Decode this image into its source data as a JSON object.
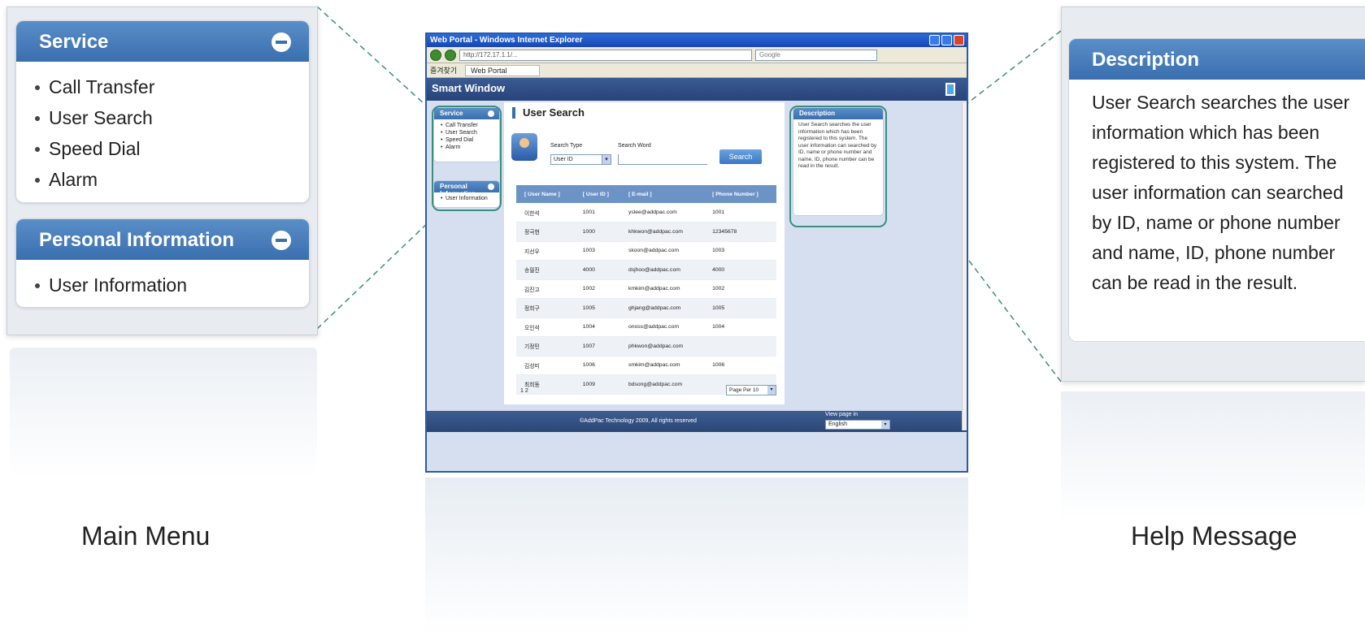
{
  "colors": {
    "accent": "#3a6faf",
    "highlight": "#3a8f7f",
    "header": "#27447a"
  },
  "zoom_menu": {
    "service_title": "Service",
    "service_items": [
      "Call Transfer",
      "User Search",
      "Speed Dial",
      "Alarm"
    ],
    "personal_title": "Personal Information",
    "personal_items": [
      "User Information"
    ]
  },
  "zoom_help": {
    "title": "Description",
    "text": "User Search searches the user information which has been registered to this system. The user information can searched by ID, name or phone number and name, ID, phone number can be read in the result."
  },
  "captions": {
    "left": "Main Menu",
    "right": "Help Message"
  },
  "browser": {
    "title": "Web Portal - Windows Internet Explorer",
    "address": "http://172.17.1.1/...",
    "search_placeholder": "Google",
    "fav_label": "즐겨찾기",
    "tab_label": "Web Portal"
  },
  "app": {
    "title": "Smart Window",
    "page_title": "User Search",
    "search_type_label": "Search Type",
    "search_word_label": "Search Word",
    "search_type_value": "User ID",
    "search_word_value": "",
    "search_button": "Search",
    "columns": [
      "[ User Name ]",
      "[ User ID ]",
      "[ E-mail ]",
      "[ Phone Number ]"
    ],
    "rows": [
      [
        "이한석",
        "1001",
        "yslee@addpac.com",
        "1001"
      ],
      [
        "정극현",
        "1000",
        "khkwon@addpac.com",
        "12345678"
      ],
      [
        "지선우",
        "1003",
        "skoon@addpac.com",
        "1003"
      ],
      [
        "송필진",
        "4000",
        "dsjhoo@addpac.com",
        "4000"
      ],
      [
        "김진고",
        "1002",
        "kmkim@addpac.com",
        "1002"
      ],
      [
        "정희구",
        "1005",
        "ghjang@addpac.com",
        "1005"
      ],
      [
        "오인석",
        "1004",
        "onoss@addpac.com",
        "1004"
      ],
      [
        "기정민",
        "1007",
        "phkwon@addpac.com",
        ""
      ],
      [
        "김성미",
        "1006",
        "smkim@addpac.com",
        "1006"
      ],
      [
        "최희동",
        "1009",
        "bdsong@addpac.com",
        ""
      ]
    ],
    "pager": "1  2",
    "per_page": "Page Per  10",
    "footer_copy": "©AddPac Technology 2009, All rights reserved",
    "view_page_label": "View page in",
    "language": "English"
  }
}
